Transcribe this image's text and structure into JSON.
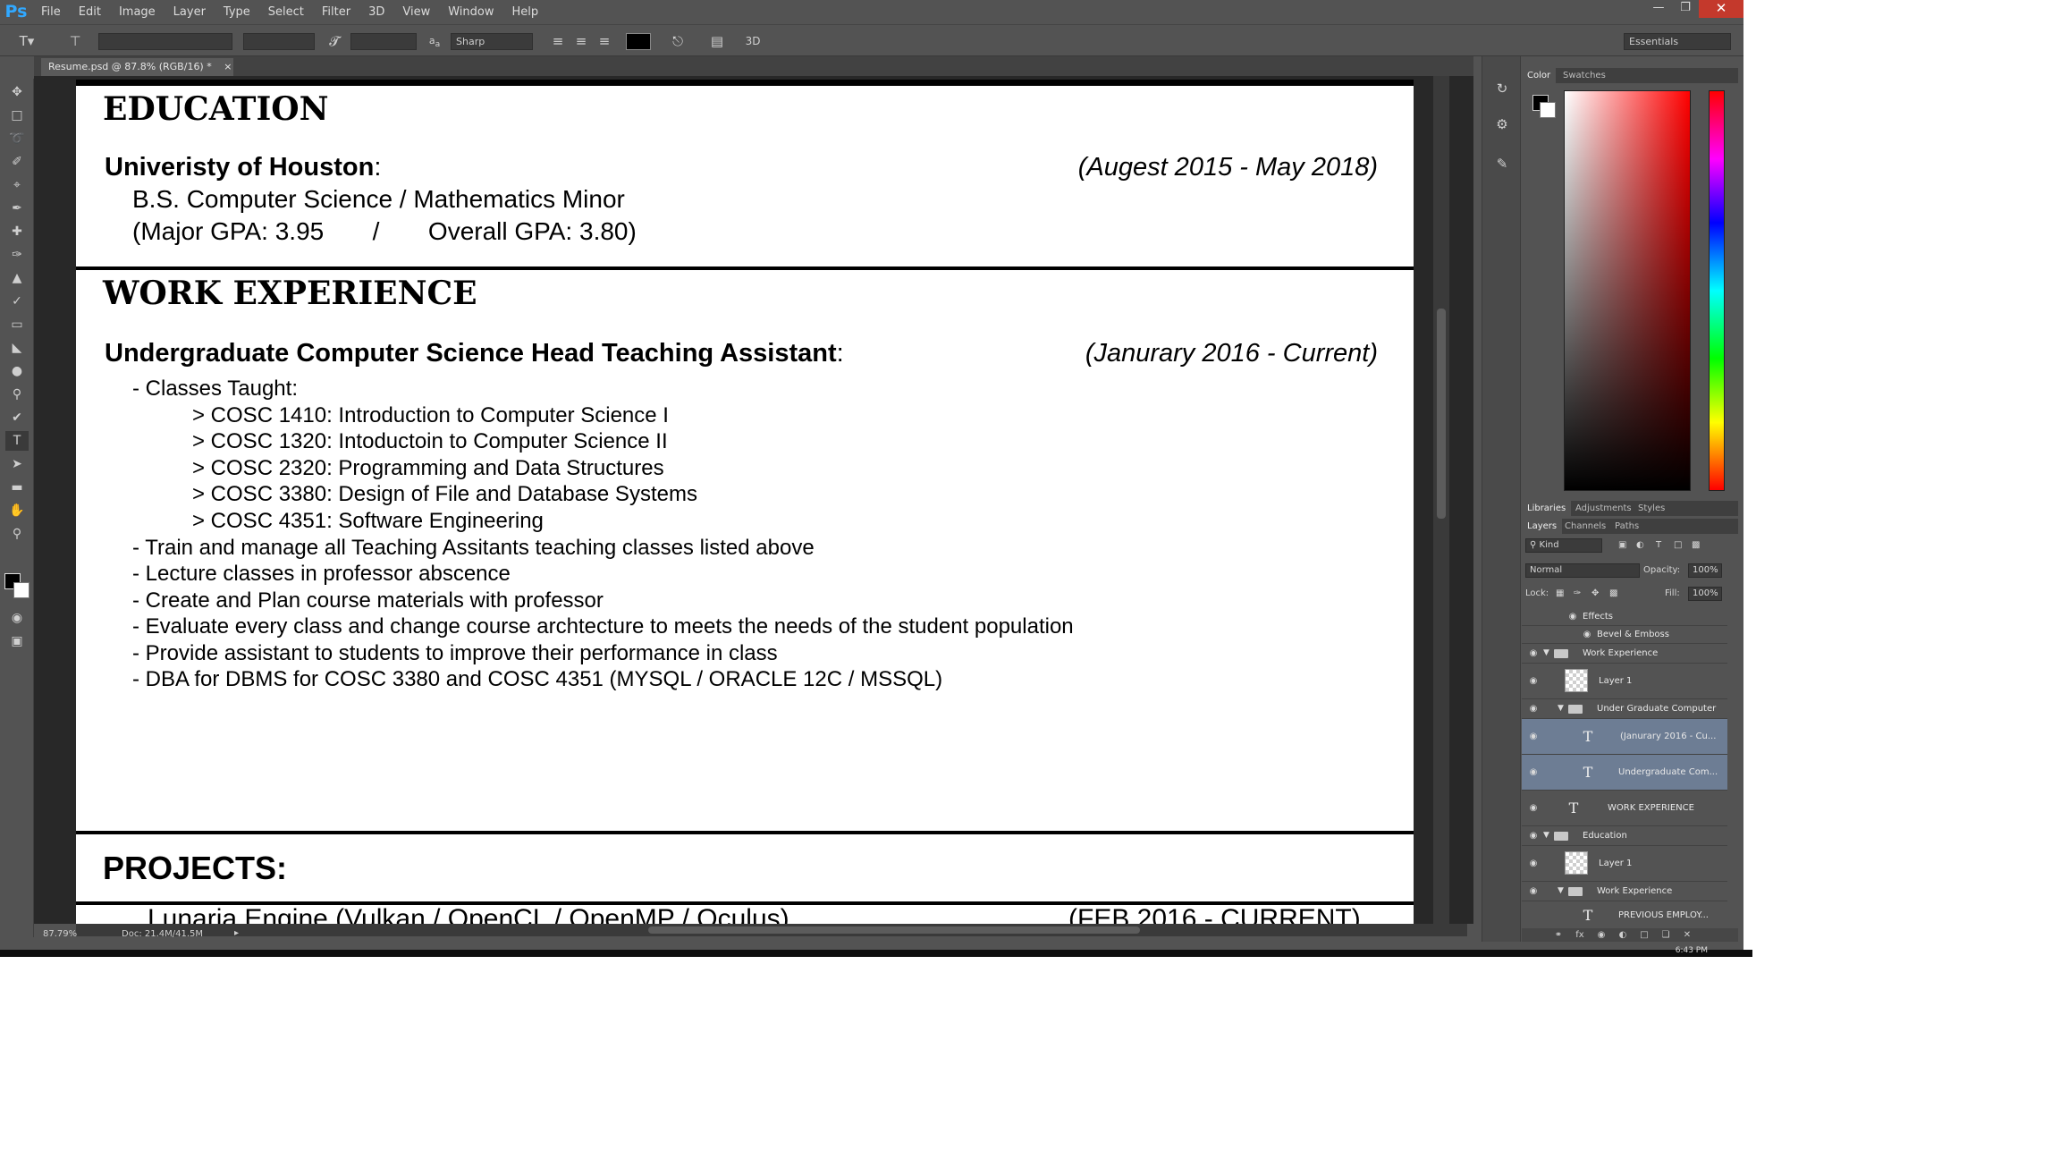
{
  "app": {
    "logo": "Ps",
    "menu": [
      "File",
      "Edit",
      "Image",
      "Layer",
      "Type",
      "Select",
      "Filter",
      "3D",
      "View",
      "Window",
      "Help"
    ]
  },
  "options": {
    "antialias": "Sharp",
    "workspace": "Essentials"
  },
  "document_tab": "Resume.psd @ 87.8% (RGB/16) *",
  "status": {
    "zoom": "87.79%",
    "doc_size": "Doc: 21.4M/41.5M"
  },
  "resume": {
    "education": {
      "title": "EDUCATION",
      "school": "Univeristy of Houston",
      "colon": ":",
      "dates": "(Augest 2015 - May 2018)",
      "degree": "B.S. Computer Science / Mathematics Minor",
      "gpa": "(Major GPA: 3.95       /       Overall GPA: 3.80)"
    },
    "work": {
      "title": "WORK EXPERIENCE",
      "role": "Undergraduate Computer Science Head Teaching Assistant",
      "colon": ":",
      "dates": "(Janurary 2016 - Current)",
      "classes_label": "- Classes Taught:",
      "classes": [
        "> COSC 1410: Introduction to Computer Science I",
        "> COSC 1320: Intoductoin to Computer Science II",
        "> COSC 2320: Programming and Data Structures",
        "> COSC 3380: Design of File and Database Systems",
        "> COSC 4351: Software Engineering"
      ],
      "duties": [
        "- Train and manage all Teaching Assitants teaching classes listed above",
        "- Lecture classes in professor abscence",
        "- Create and Plan course materials with professor",
        "- Evaluate every class and change course archtecture to meets the needs of the student population",
        "- Provide assistant to students to improve their performance in class",
        "- DBA for DBMS for COSC 3380 and COSC 4351 (MYSQL / ORACLE 12C / MSSQL)"
      ]
    },
    "projects": {
      "title": "PROJECTS:",
      "first_entry_partial": "Lunaria Engine (Vulkan / OpenCL / OpenMP / Oculus)",
      "first_entry_dates_partial": "(FEB 2016 - CURRENT)"
    }
  },
  "panels": {
    "color_tabs": [
      "Color",
      "Swatches"
    ],
    "library_tabs": [
      "Libraries",
      "Adjustments",
      "Styles"
    ],
    "layer_tabs": [
      "Layers",
      "Channels",
      "Paths"
    ],
    "kind_filter": "Kind",
    "blend_mode": "Normal",
    "opacity_label": "Opacity:",
    "opacity": "100%",
    "lock_label": "Lock:",
    "fill_label": "Fill:",
    "fill": "100%",
    "layers": [
      {
        "name": "Effects"
      },
      {
        "name": "Bevel & Emboss"
      },
      {
        "name": "Work Experience"
      },
      {
        "name": "Layer 1"
      },
      {
        "name": "Under Graduate Computer"
      },
      {
        "name": "(Janurary 2016 - Cu..."
      },
      {
        "name": "Undergraduate Com..."
      },
      {
        "name": "WORK EXPERIENCE"
      },
      {
        "name": "Education"
      },
      {
        "name": "Layer 1"
      },
      {
        "name": "Work Experience"
      },
      {
        "name": "PREVIOUS EMPLOY..."
      }
    ]
  },
  "taskbar": {
    "time": "6:43 PM"
  }
}
